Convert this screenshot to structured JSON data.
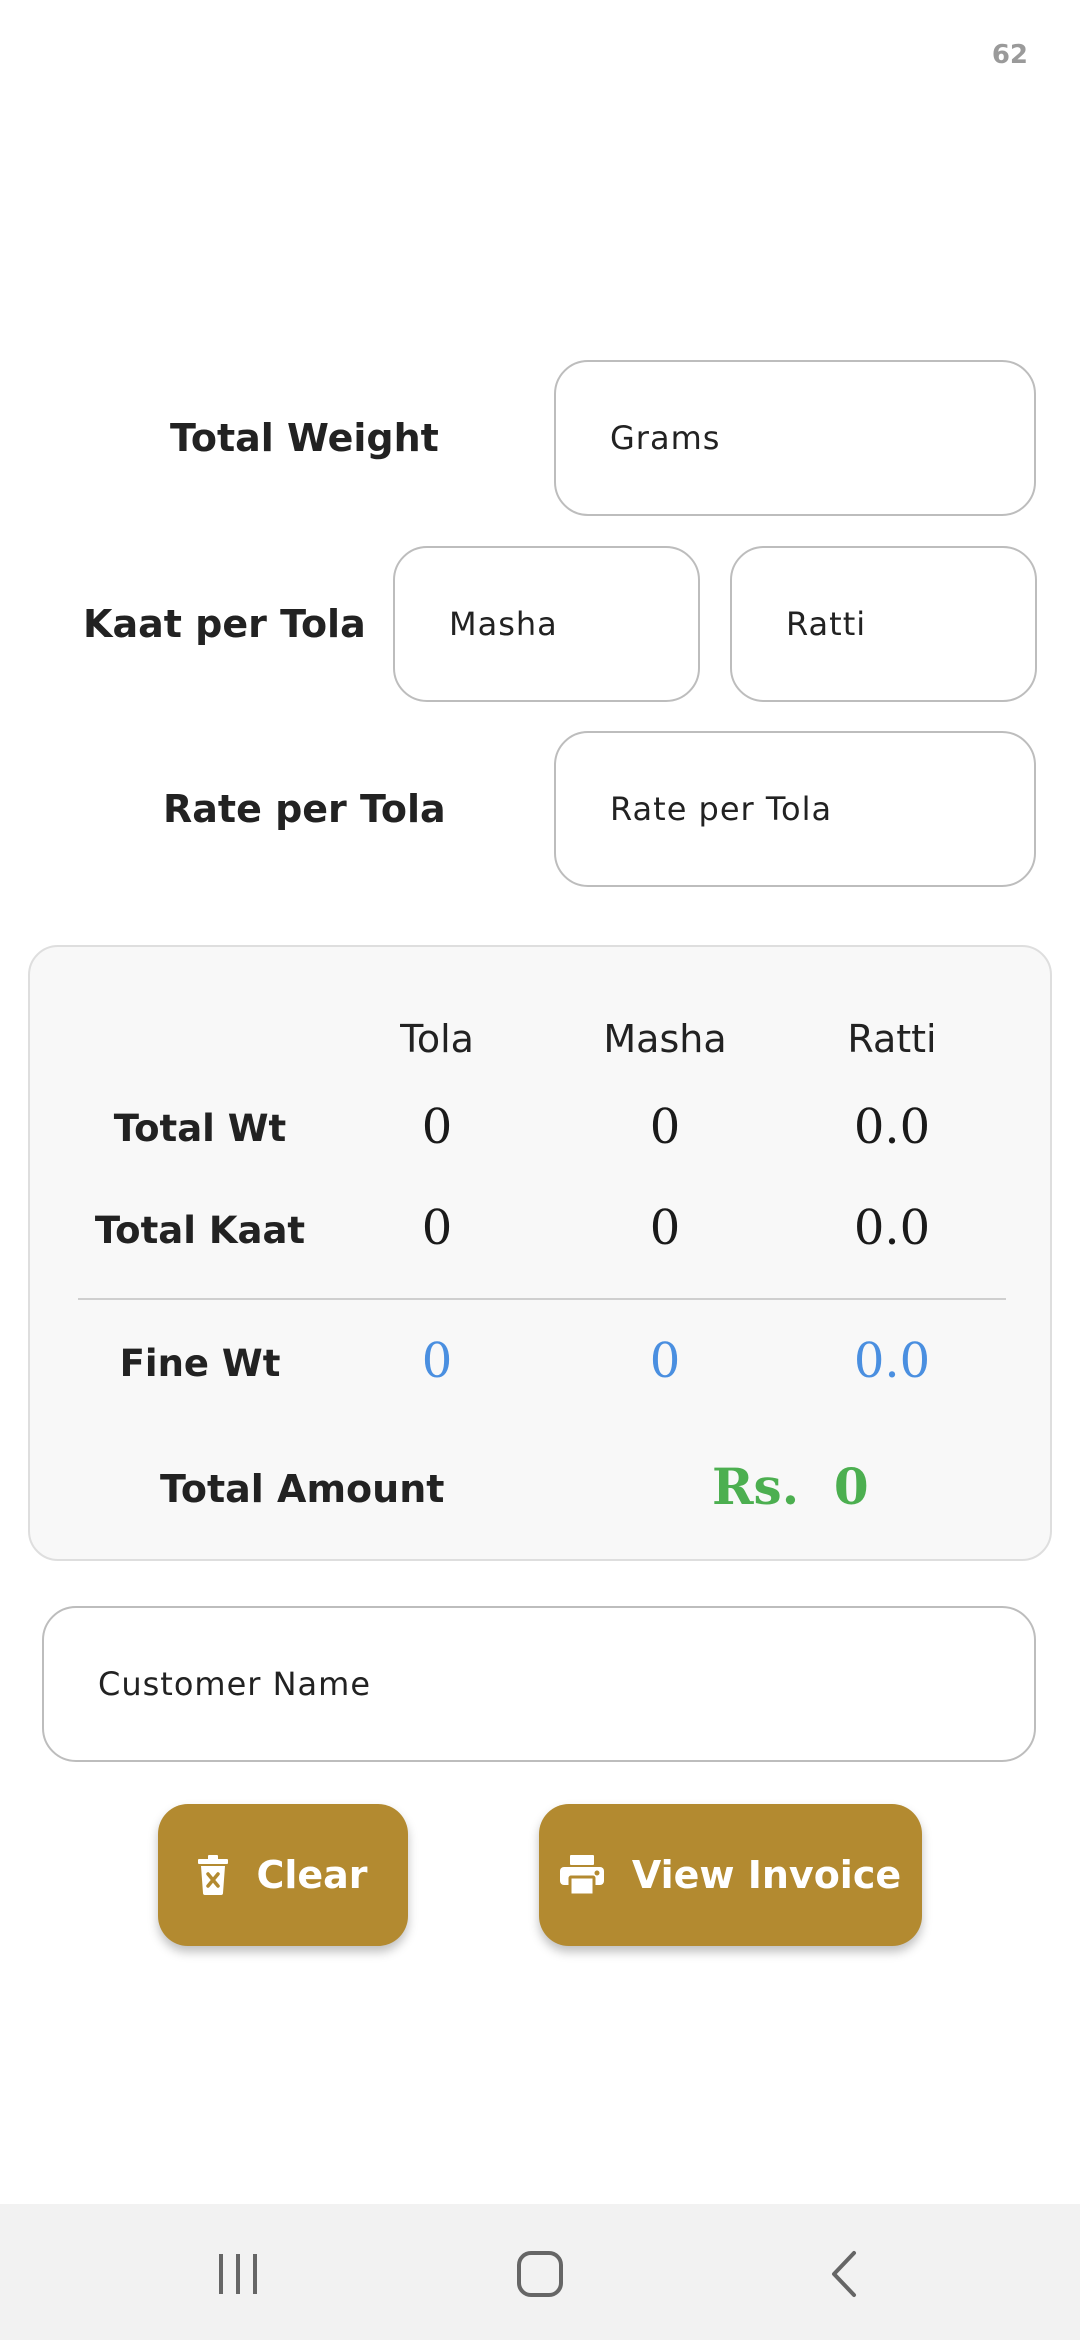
{
  "status": {
    "count": "62"
  },
  "inputs": {
    "total_weight": {
      "label": "Total Weight",
      "placeholder": "Grams",
      "value": ""
    },
    "kaat_per_tola": {
      "label": "Kaat per Tola",
      "masha_placeholder": "Masha",
      "masha_value": "",
      "ratti_placeholder": "Ratti",
      "ratti_value": ""
    },
    "rate_per_tola": {
      "label": "Rate per Tola",
      "placeholder": "Rate per Tola",
      "value": ""
    }
  },
  "summary": {
    "columns": [
      "Tola",
      "Masha",
      "Ratti"
    ],
    "rows": [
      {
        "label": "Total Wt",
        "values": [
          "0",
          "0",
          "0.0"
        ]
      },
      {
        "label": "Total Kaat",
        "values": [
          "0",
          "0",
          "0.0"
        ]
      }
    ],
    "fine": {
      "label": "Fine Wt",
      "values": [
        "0",
        "0",
        "0.0"
      ]
    },
    "total_amount": {
      "label": "Total Amount",
      "value": "Rs.  0"
    }
  },
  "customer": {
    "placeholder": "Customer Name",
    "value": ""
  },
  "actions": {
    "clear_label": "Clear",
    "view_invoice_label": "View Invoice"
  },
  "colors": {
    "accent": "#b38a30",
    "fine": "#4a8fe0",
    "amount": "#4caf50"
  },
  "icons": {
    "clear": "trash-icon",
    "view_invoice": "printer-icon"
  }
}
